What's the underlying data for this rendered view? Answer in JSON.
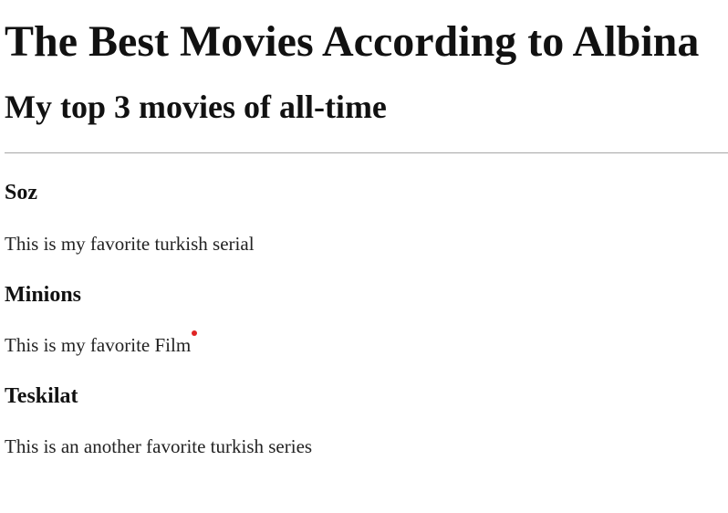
{
  "page": {
    "title": "The Best Movies According to Albina",
    "subtitle": "My top 3 movies of all-time"
  },
  "movies": [
    {
      "name": "Soz",
      "description": "This is my favorite turkish serial"
    },
    {
      "name": "Minions",
      "description": "This is my favorite Film"
    },
    {
      "name": "Teskilat",
      "description": "This is an another favorite turkish series"
    }
  ],
  "colors": {
    "text": "#111111",
    "divider": "#a7a7a7",
    "cursor": "#e02424"
  }
}
